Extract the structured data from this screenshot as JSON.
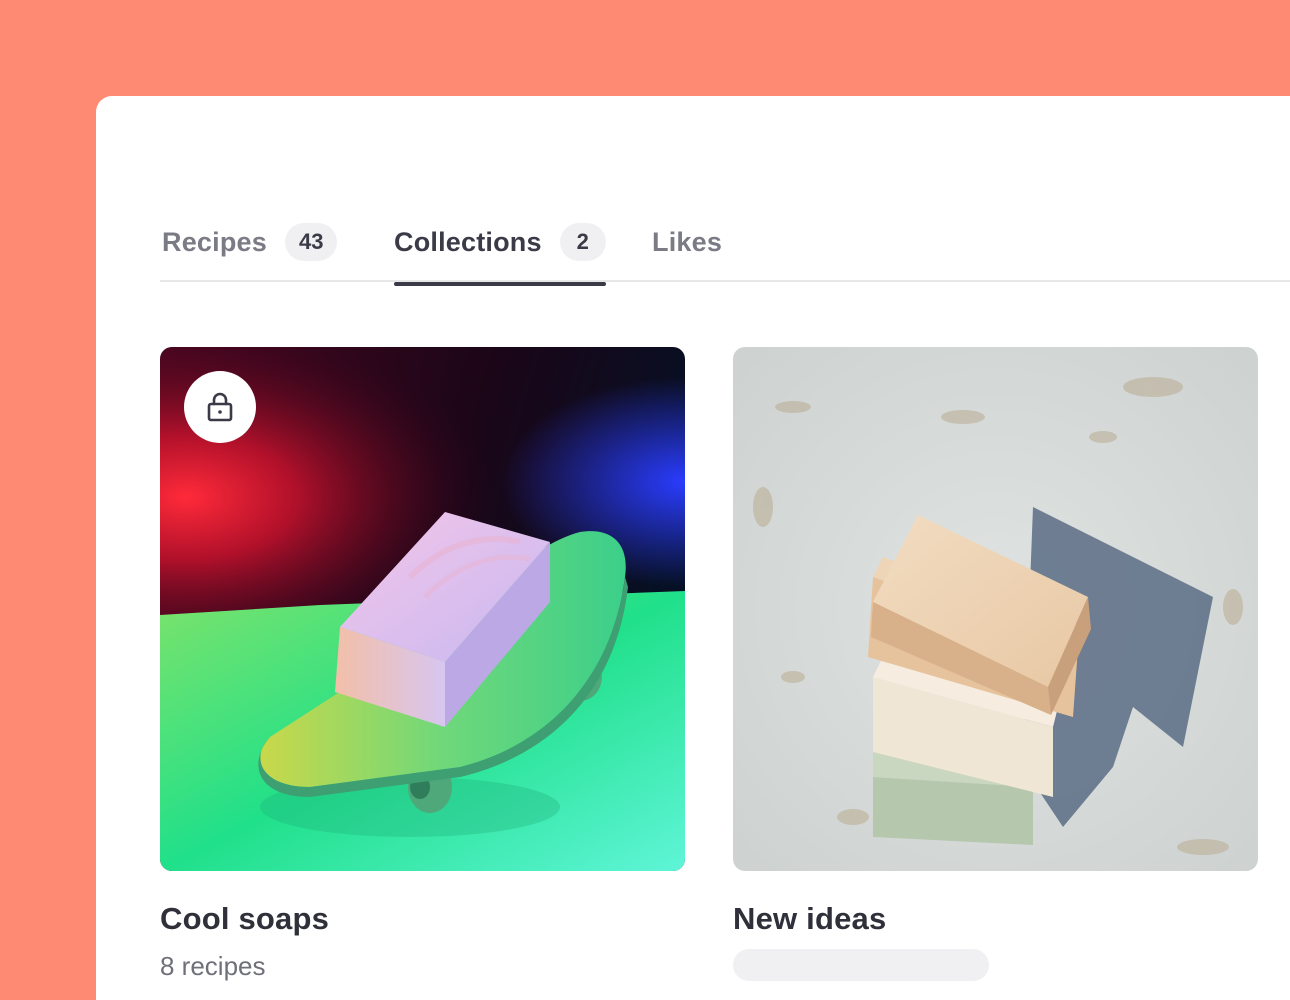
{
  "tabs": [
    {
      "label": "Recipes",
      "count": "43",
      "active": false
    },
    {
      "label": "Collections",
      "count": "2",
      "active": true
    },
    {
      "label": "Likes",
      "active": false
    }
  ],
  "collections": [
    {
      "title": "Cool soaps",
      "subtitle": "8 recipes",
      "private": true,
      "lock_icon": "lock-icon"
    },
    {
      "title": "New ideas",
      "subtitle_loading": true
    }
  ],
  "colors": {
    "background": "#FF8A73",
    "text_primary": "#3a3b47",
    "text_muted": "#7a7b85",
    "pill": "#f0f0f2"
  }
}
